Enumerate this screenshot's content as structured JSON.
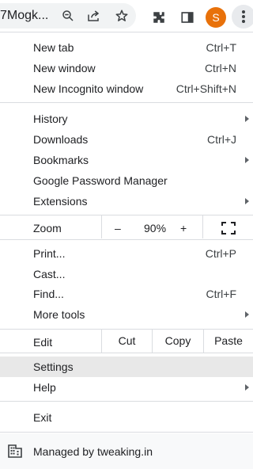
{
  "toolbar": {
    "url_fragment": "7Mogk...",
    "profile_initial": "S",
    "icons": [
      "zoom-icon",
      "share-icon",
      "bookmark-star-icon",
      "extensions-icon",
      "side-panel-icon",
      "kebab-menu-icon"
    ]
  },
  "menu": {
    "group1": [
      {
        "label": "New tab",
        "shortcut": "Ctrl+T"
      },
      {
        "label": "New window",
        "shortcut": "Ctrl+N"
      },
      {
        "label": "New Incognito window",
        "shortcut": "Ctrl+Shift+N"
      }
    ],
    "group2": [
      {
        "label": "History",
        "submenu": true
      },
      {
        "label": "Downloads",
        "shortcut": "Ctrl+J"
      },
      {
        "label": "Bookmarks",
        "submenu": true
      },
      {
        "label": "Google Password Manager"
      },
      {
        "label": "Extensions",
        "submenu": true
      }
    ],
    "zoom": {
      "label": "Zoom",
      "minus": "–",
      "value": "90%",
      "plus": "+"
    },
    "group3": [
      {
        "label": "Print...",
        "shortcut": "Ctrl+P"
      },
      {
        "label": "Cast..."
      },
      {
        "label": "Find...",
        "shortcut": "Ctrl+F"
      },
      {
        "label": "More tools",
        "submenu": true
      }
    ],
    "edit": {
      "label": "Edit",
      "cut": "Cut",
      "copy": "Copy",
      "paste": "Paste"
    },
    "group4": [
      {
        "label": "Settings",
        "active": true
      },
      {
        "label": "Help",
        "submenu": true
      }
    ],
    "exit": {
      "label": "Exit"
    },
    "managed": {
      "label": "Managed by tweaking.in"
    }
  },
  "colors": {
    "avatar": "#e8710a",
    "hover": "#e8e8e8",
    "separator": "#dadce0"
  }
}
